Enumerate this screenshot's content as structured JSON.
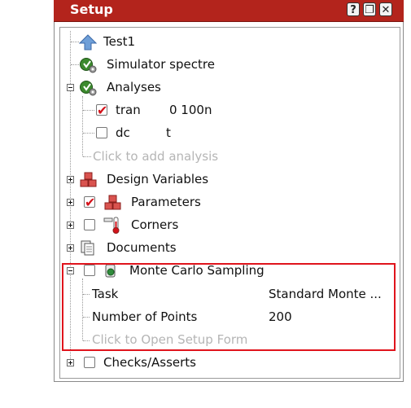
{
  "window": {
    "title": "Setup"
  },
  "titlebar_buttons": {
    "help": "?",
    "restore": "❐",
    "close": "✕"
  },
  "tree": {
    "test": "Test1",
    "simulator": "Simulator spectre",
    "analyses": {
      "label": "Analyses",
      "items": [
        {
          "name": "tran",
          "value": "0 100n",
          "checked": true
        },
        {
          "name": "dc",
          "value": "t",
          "checked": false
        }
      ],
      "add": "Click to add analysis"
    },
    "design_variables": "Design Variables",
    "parameters": "Parameters",
    "corners": "Corners",
    "documents": "Documents",
    "monte_carlo": {
      "label": "Monte Carlo Sampling",
      "task_label": "Task",
      "task_value": "Standard Monte ...",
      "points_label": "Number of Points",
      "points_value": "200",
      "open_form": "Click to Open Setup Form"
    },
    "checks": "Checks/Asserts"
  },
  "colors": {
    "titlebar": "#b3241c",
    "highlight": "#e0141c",
    "check": "#d4121a"
  }
}
